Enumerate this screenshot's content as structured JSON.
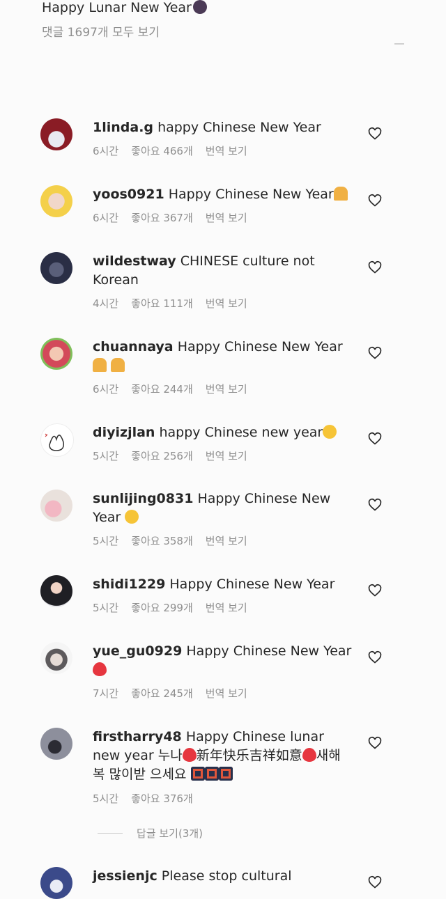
{
  "header": {
    "caption": "Happy Lunar New Year",
    "view_all_comments": "댓글 1697개 모두 보기"
  },
  "translate_label": "번역 보기",
  "comments": [
    {
      "user": "1linda.g",
      "text": "happy Chinese New Year",
      "time": "6시간",
      "likes": "좋아요 466개"
    },
    {
      "user": "yoos0921",
      "text": "Happy Chinese New Year",
      "time": "6시간",
      "likes": "좋아요 367개"
    },
    {
      "user": "wildestway",
      "text": "CHINESE culture not Korean",
      "time": "4시간",
      "likes": "좋아요 111개"
    },
    {
      "user": "chuannaya",
      "text": "Happy Chinese New Year",
      "time": "6시간",
      "likes": "좋아요 244개"
    },
    {
      "user": "diyizjlan",
      "text": "happy Chinese new year",
      "time": "5시간",
      "likes": "좋아요 256개"
    },
    {
      "user": "sunlijing0831",
      "text": "Happy Chinese New Year",
      "time": "5시간",
      "likes": "좋아요 358개"
    },
    {
      "user": "shidi1229",
      "text": "Happy Chinese New Year",
      "time": "5시간",
      "likes": "좋아요 299개"
    },
    {
      "user": "yue_gu0929",
      "text": "Happy Chinese New Year",
      "time": "7시간",
      "likes": "좋아요 245개"
    },
    {
      "user": "firstharry48",
      "text_a": "Happy Chinese lunar new year 누나",
      "text_b": "新年快乐吉祥如意",
      "text_c": "새해 복 많이받 으세요",
      "time": "5시간",
      "likes": "좋아요 376개"
    },
    {
      "user": "jessienjc",
      "text": "Please stop cultural"
    }
  ],
  "replies_label": "답글 보기(3개)",
  "colors": {
    "text": "#262626",
    "muted": "#8e8e8e",
    "background": "#fbfbfb"
  },
  "icons": {
    "like": "heart-outline-icon"
  }
}
